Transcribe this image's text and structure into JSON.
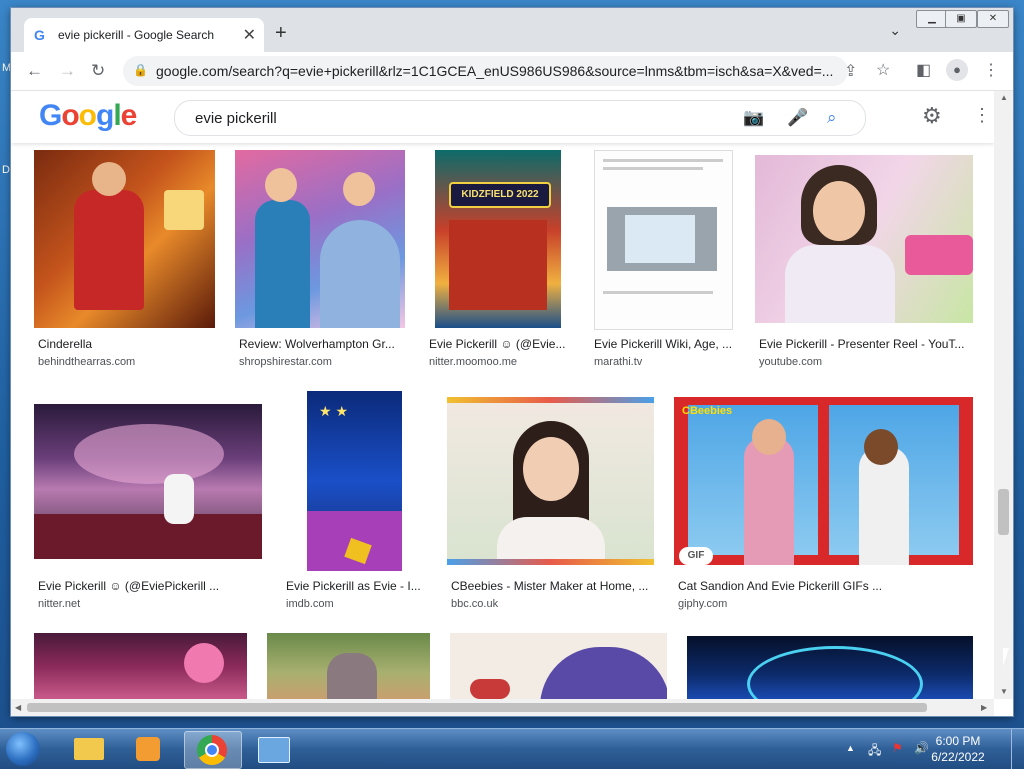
{
  "tab": {
    "title": "evie pickerill - Google Search",
    "new_tab": "+",
    "close": "✕"
  },
  "toolbar": {
    "url": "google.com/search?q=evie+pickerill&rlz=1C1GCEA_enUS986US986&source=lnms&tbm=isch&sa=X&ved=..."
  },
  "search": {
    "logo": "Google",
    "query": "evie pickerill"
  },
  "results": [
    {
      "caption": "Cinderella",
      "source": "behindthearras.com"
    },
    {
      "caption": "Review: Wolverhampton Gr...",
      "source": "shropshirestar.com"
    },
    {
      "caption": "Evie Pickerill ☺ (@Evie...",
      "source": "nitter.moomoo.me"
    },
    {
      "caption": "Evie Pickerill Wiki, Age, ...",
      "source": "marathi.tv"
    },
    {
      "caption": "Evie Pickerill - Presenter Reel - YouT...",
      "source": "youtube.com"
    },
    {
      "caption": "Evie Pickerill ☺ (@EviePickerill ...",
      "source": "nitter.net"
    },
    {
      "caption": "Evie Pickerill as Evie - I...",
      "source": "imdb.com"
    },
    {
      "caption": "CBeebies - Mister Maker at Home, ...",
      "source": "bbc.co.uk"
    },
    {
      "caption": "Cat Sandion And Evie Pickerill GIFs ...",
      "source": "giphy.com"
    }
  ],
  "poster_title": "KIDZFIELD 2022",
  "cbeebies_logo": "CBeebies",
  "gif_badge": "GIF",
  "desktop": {
    "letter1": "M",
    "letter2": "D"
  },
  "clock": {
    "time": "6:00 PM",
    "date": "6/22/2022"
  },
  "colors": {
    "google_blue": "#4285f4",
    "google_red": "#ea4335",
    "google_yellow": "#fbbc05",
    "google_green": "#34a853"
  }
}
